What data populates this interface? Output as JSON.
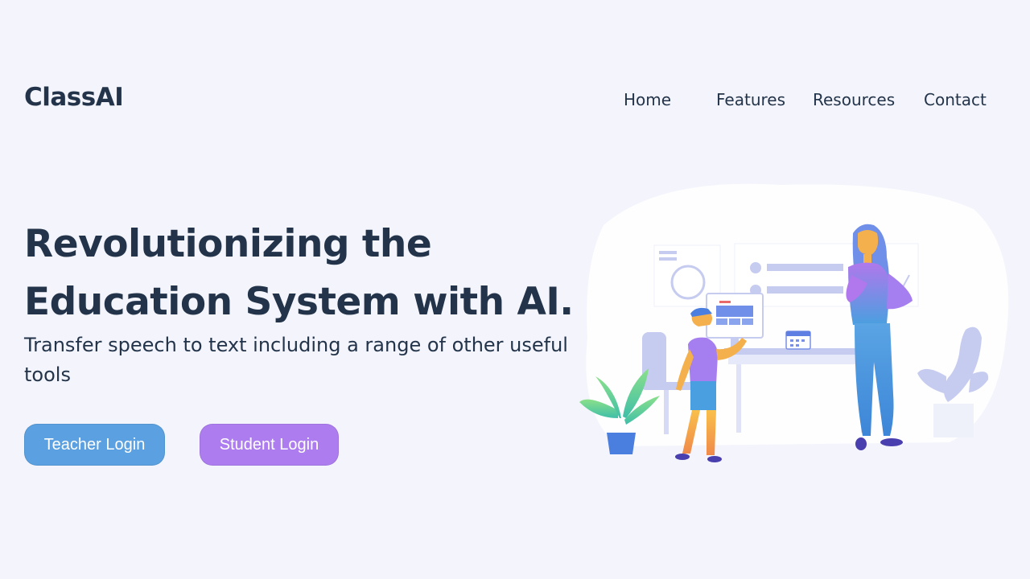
{
  "header": {
    "logo": "ClassAI",
    "nav": [
      {
        "label": "Home"
      },
      {
        "label": "Features"
      },
      {
        "label": "Resources"
      },
      {
        "label": "Contact"
      }
    ]
  },
  "hero": {
    "title_line1": "Revolutionizing the",
    "title_line2": "Education System with AI.",
    "subtitle": "Transfer speech to text including a range of other useful tools",
    "buttons": {
      "teacher": "Teacher Login",
      "student": "Student Login"
    }
  },
  "illustration": {
    "icon": "classroom-illustration",
    "colors": {
      "background_blob": "#ffffff",
      "teacher_top": "#b078ec",
      "teacher_bottom": "#4a9fe0",
      "student_shirt": "#a57ff0",
      "skin": "#f4b04c",
      "plant_green": "#7ad98a",
      "pot": "#4a7fe0",
      "furniture": "#c6cbf0"
    }
  },
  "colors": {
    "page_bg": "#f4f5fc",
    "text": "#23344a",
    "teacher_button": "#5ba0e0",
    "student_button": "#ad7df0"
  }
}
